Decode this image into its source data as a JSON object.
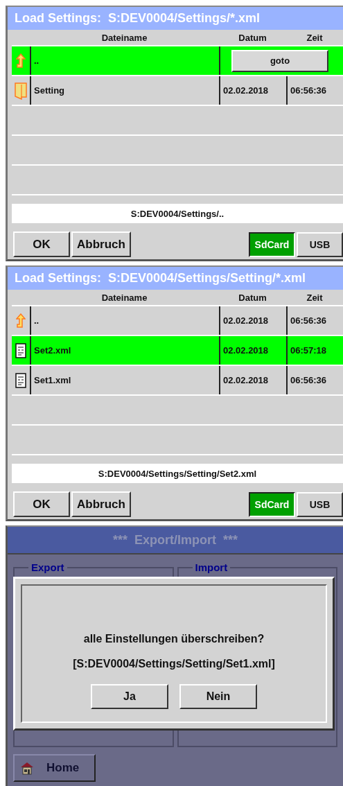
{
  "file_dialogs": [
    {
      "title": "Load Settings:  S:DEV0004/Settings/*.xml",
      "columns": [
        "Dateiname",
        "Datum",
        "Zeit"
      ],
      "rows": [
        {
          "kind": "up",
          "name": "..",
          "selected": true,
          "action": "goto"
        },
        {
          "kind": "folder",
          "name": "Setting",
          "date": "02.02.2018",
          "time": "06:56:36",
          "selected": false
        }
      ],
      "path": "S:DEV0004/Settings/..",
      "buttons": [
        "OK",
        "Abbruch"
      ],
      "sources": [
        {
          "label": "SdCard",
          "selected": true
        },
        {
          "label": "USB",
          "selected": false
        }
      ]
    },
    {
      "title": "Load Settings:  S:DEV0004/Settings/Setting/*.xml",
      "columns": [
        "Dateiname",
        "Datum",
        "Zeit"
      ],
      "rows": [
        {
          "kind": "up",
          "name": "..",
          "date": "02.02.2018",
          "time": "06:56:36",
          "selected": false
        },
        {
          "kind": "file",
          "name": "Set2.xml",
          "date": "02.02.2018",
          "time": "06:57:18",
          "selected": true
        },
        {
          "kind": "file",
          "name": "Set1.xml",
          "date": "02.02.2018",
          "time": "06:56:36",
          "selected": false
        }
      ],
      "path": "S:DEV0004/Settings/Setting/Set2.xml",
      "buttons": [
        "OK",
        "Abbruch"
      ],
      "sources": [
        {
          "label": "SdCard",
          "selected": true
        },
        {
          "label": "USB",
          "selected": false
        }
      ]
    }
  ],
  "export_import": {
    "title": "***  Export/Import  ***",
    "groups": [
      "Export",
      "Import"
    ],
    "dialog": {
      "message": "alle Einstellungen überschreiben?",
      "file": "[S:DEV0004/Settings/Setting/Set1.xml]",
      "buttons": [
        "Ja",
        "Nein"
      ]
    },
    "home_button": "Home"
  }
}
